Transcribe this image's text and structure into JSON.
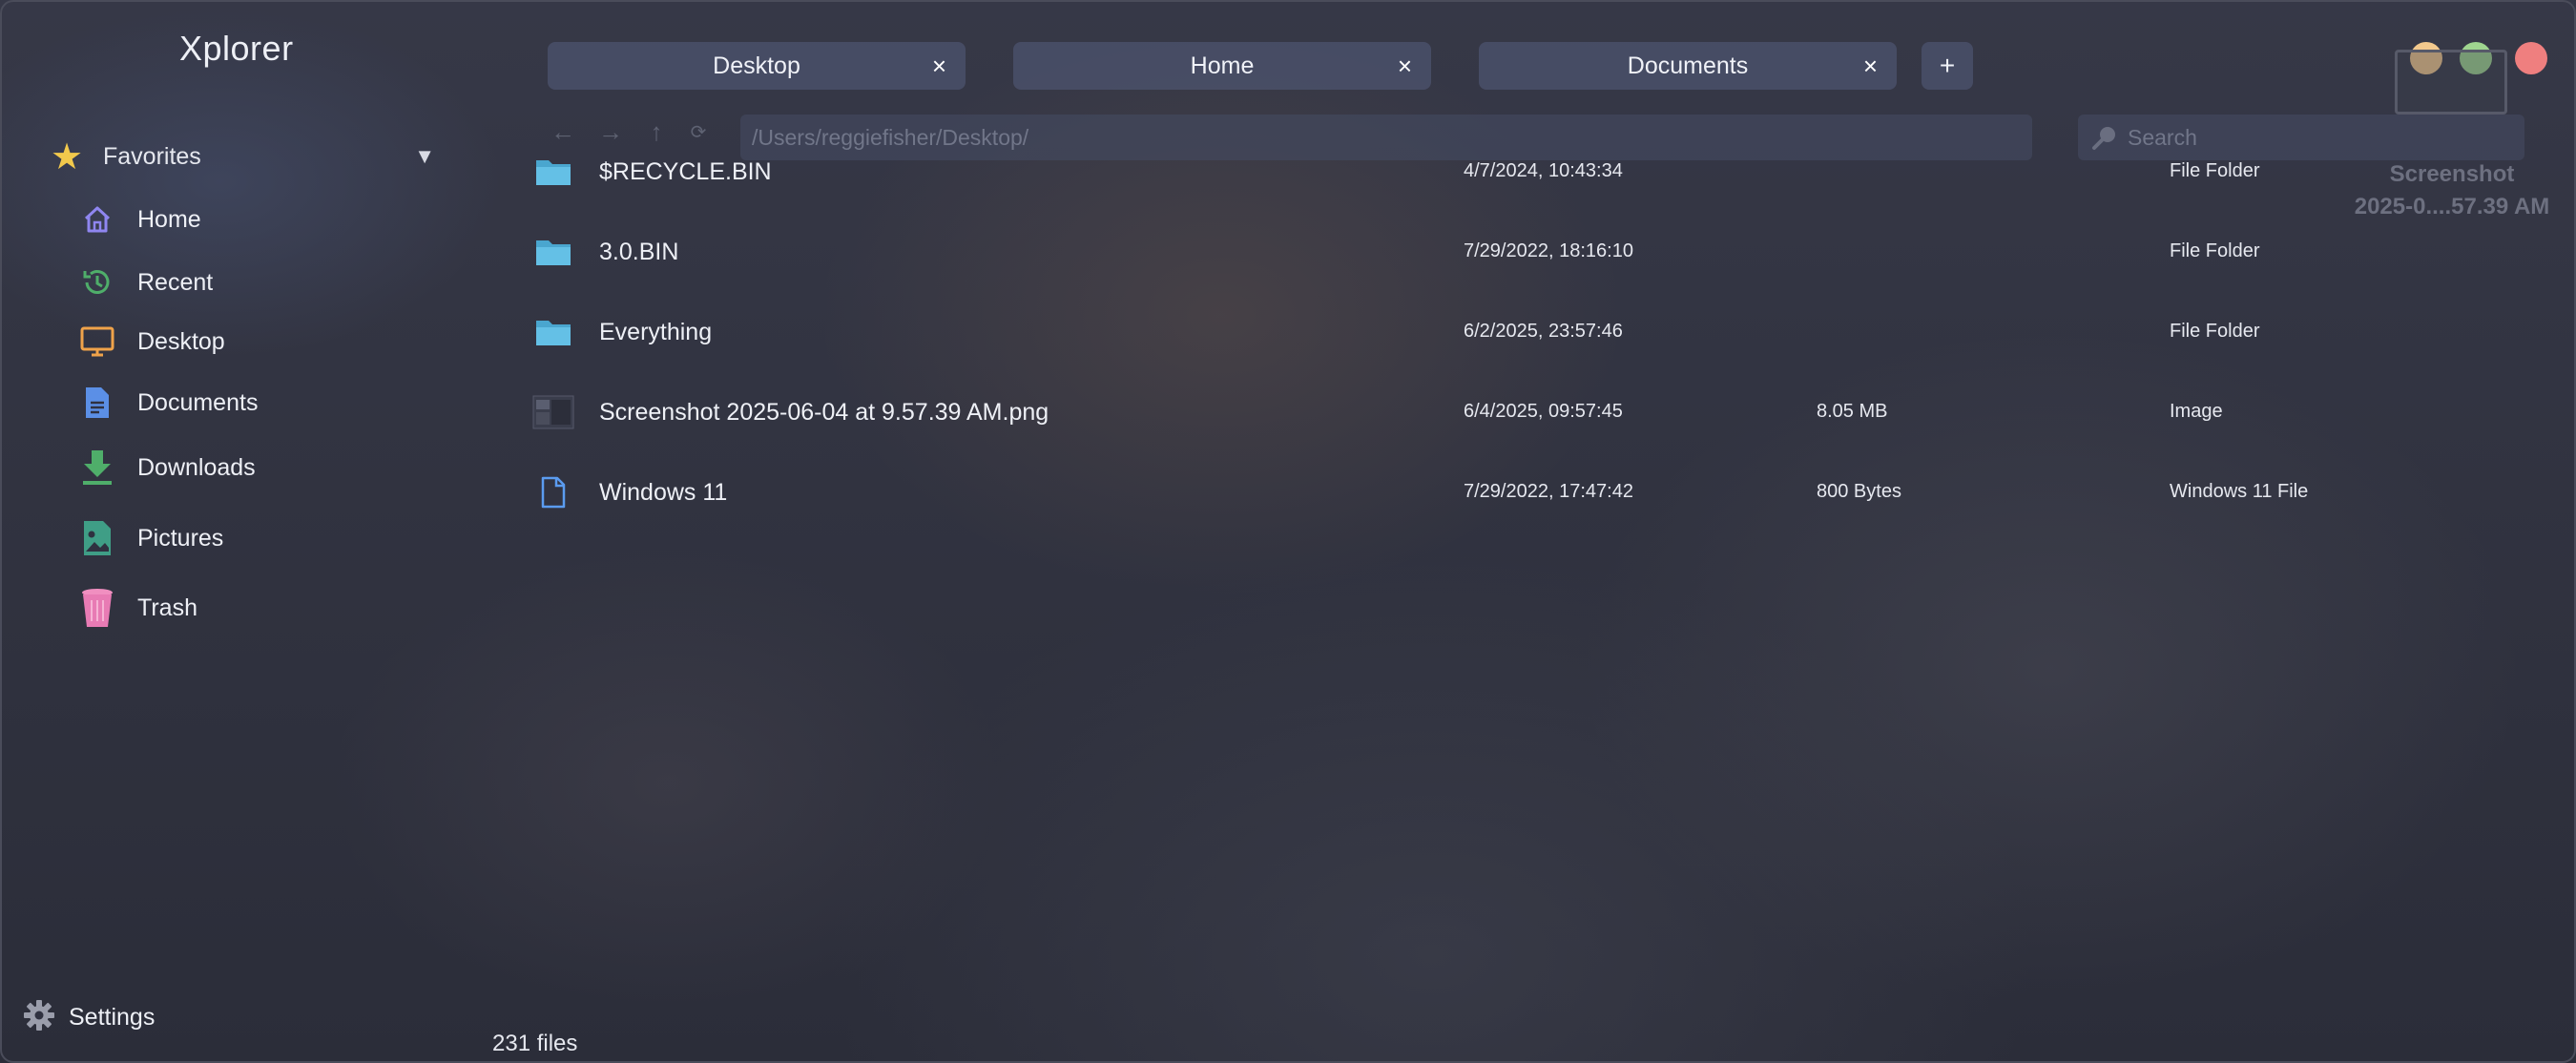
{
  "app": {
    "title": "Xplorer"
  },
  "sidebar": {
    "favorites_label": "Favorites",
    "items": [
      {
        "label": "Home",
        "icon": "home-icon"
      },
      {
        "label": "Recent",
        "icon": "recent-icon"
      },
      {
        "label": "Desktop",
        "icon": "desktop-icon"
      },
      {
        "label": "Documents",
        "icon": "documents-icon"
      },
      {
        "label": "Downloads",
        "icon": "downloads-icon"
      },
      {
        "label": "Pictures",
        "icon": "pictures-icon"
      },
      {
        "label": "Trash",
        "icon": "trash-icon"
      }
    ],
    "settings_label": "Settings"
  },
  "tabs": [
    {
      "label": "Desktop",
      "close": "×"
    },
    {
      "label": "Home",
      "close": "×"
    },
    {
      "label": "Documents",
      "close": "×"
    }
  ],
  "tab_add_label": "+",
  "nav": {
    "path": "/Users/reggiefisher/Desktop/",
    "search_placeholder": "Search"
  },
  "preview": {
    "name_line1": "Screenshot",
    "name_line2": "2025-0....57.39 AM"
  },
  "files": [
    {
      "name": "$RECYCLE.BIN",
      "modified": "4/7/2024, 10:43:34",
      "size": "",
      "type": "File Folder",
      "icon": "folder-icon"
    },
    {
      "name": "3.0.BIN",
      "modified": "7/29/2022, 18:16:10",
      "size": "",
      "type": "File Folder",
      "icon": "folder-icon"
    },
    {
      "name": "Everything",
      "modified": "6/2/2025, 23:57:46",
      "size": "",
      "type": "File Folder",
      "icon": "folder-icon"
    },
    {
      "name": "Screenshot 2025-06-04 at 9.57.39 AM.png",
      "modified": "6/4/2025, 09:57:45",
      "size": "8.05 MB",
      "type": "Image",
      "icon": "image-thumbnail-icon"
    },
    {
      "name": "Windows 11",
      "modified": "7/29/2022, 17:47:42",
      "size": "800 Bytes",
      "type": "Windows 11 File",
      "icon": "file-icon"
    }
  ],
  "status": {
    "count": "231 files"
  },
  "colors": {
    "accent_star": "#f2c94c",
    "folder": "#5ab8dc",
    "window_min": "#f3c98d",
    "window_max": "#9fd58f",
    "window_close": "#ef7f7f"
  }
}
